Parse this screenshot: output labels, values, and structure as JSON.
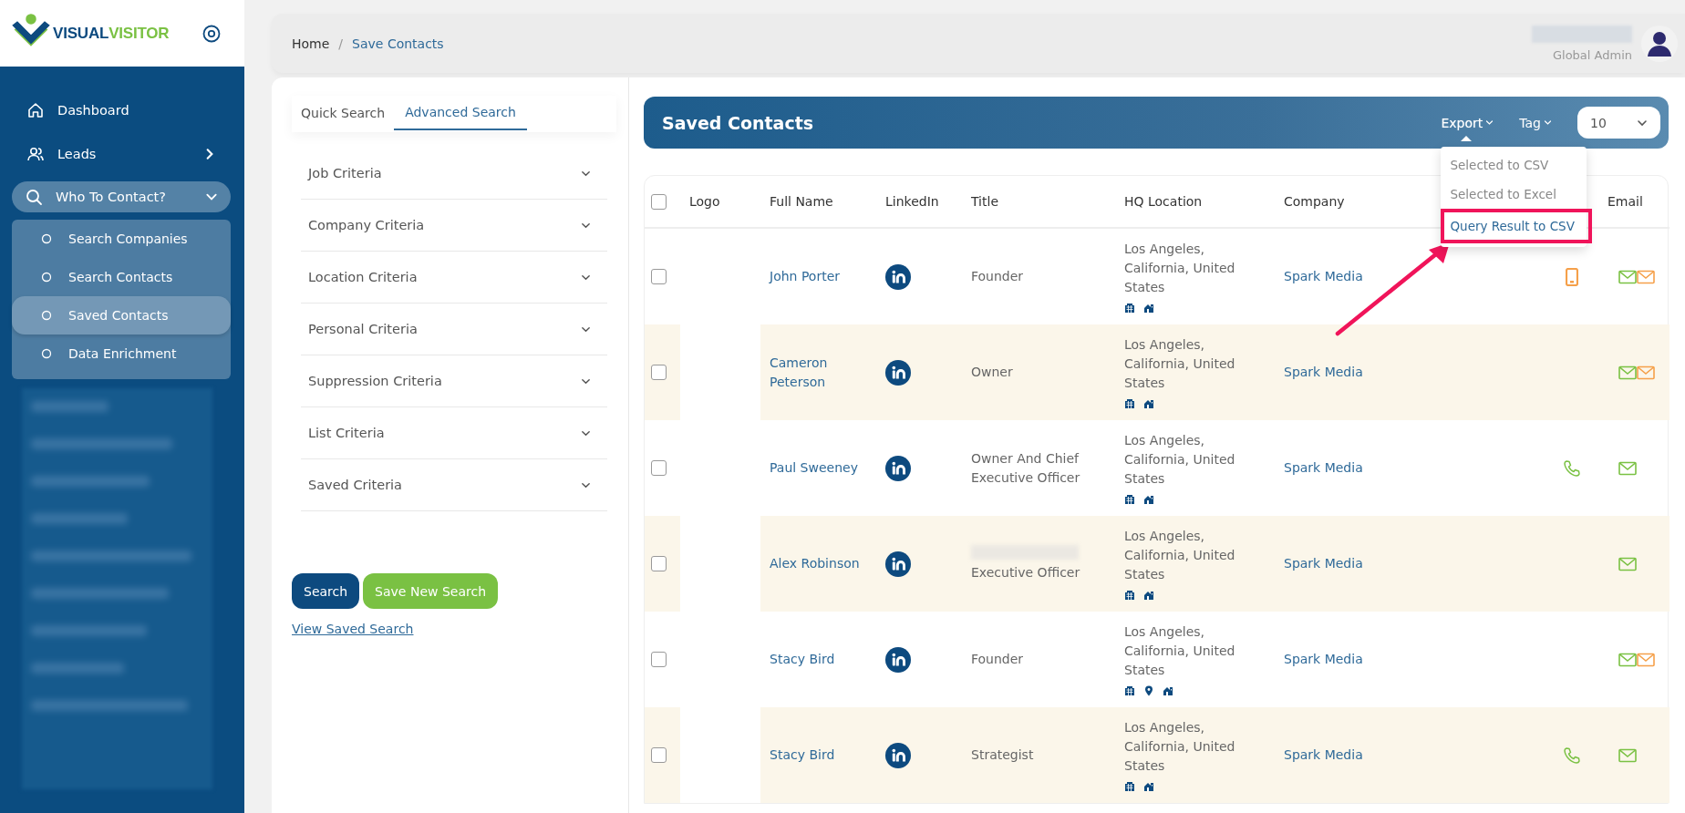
{
  "sidebar": {
    "logo": [
      {
        "text": "VISUAL",
        "color": "#0d4a7f"
      },
      {
        "text": "VISITOR",
        "color": "#7ac143"
      }
    ],
    "items": [
      {
        "label": "Dashboard",
        "selected": false
      },
      {
        "label": "Leads",
        "expanded": false,
        "selected": false
      },
      {
        "label": "Who To Contact?",
        "expanded": true,
        "selected": true,
        "children": [
          {
            "label": "Search Companies",
            "selected": false
          },
          {
            "label": "Search Contacts",
            "selected": false
          },
          {
            "label": "Saved Contacts",
            "selected": true
          },
          {
            "label": "Data Enrichment",
            "selected": false
          }
        ]
      }
    ]
  },
  "breadcrumb": {
    "items": [
      "Home",
      "Save Contacts"
    ],
    "separator": "/"
  },
  "user": {
    "role": "Global Admin"
  },
  "search_panel": {
    "tabs": [
      {
        "label": "Quick Search",
        "selected": false
      },
      {
        "label": "Advanced Search",
        "selected": true
      }
    ],
    "criteria": [
      {
        "label": "Job Criteria",
        "expanded": false
      },
      {
        "label": "Company Criteria",
        "expanded": false
      },
      {
        "label": "Location Criteria",
        "expanded": false
      },
      {
        "label": "Personal Criteria",
        "expanded": false
      },
      {
        "label": "Suppression Criteria",
        "expanded": false
      },
      {
        "label": "List Criteria",
        "expanded": false
      },
      {
        "label": "Saved Criteria",
        "expanded": false
      }
    ],
    "search_button": "Search",
    "save_button": "Save New Search",
    "saved_link": "View Saved Search"
  },
  "results": {
    "title": "Saved Contacts",
    "export": {
      "label": "Export",
      "expanded": true,
      "menu": [
        {
          "label": "Selected to CSV",
          "highlighted": false
        },
        {
          "label": "Selected to Excel",
          "highlighted": false
        },
        {
          "label": "Query Result to CSV",
          "highlighted": true
        }
      ]
    },
    "tag": {
      "label": "Tag",
      "expanded": false
    },
    "page_size": "10",
    "annotation_arrow": true,
    "table": {
      "select_all": {
        "checked": false
      },
      "columns": [
        {
          "kind": "check"
        },
        {
          "kind": "text",
          "label": "Logo"
        },
        {
          "kind": "text",
          "label": "Full Name"
        },
        {
          "kind": "text",
          "label": "LinkedIn"
        },
        {
          "kind": "text",
          "label": "Title"
        },
        {
          "kind": "text",
          "label": "HQ Location"
        },
        {
          "kind": "text",
          "label": "Company"
        },
        {
          "kind": "phone"
        },
        {
          "kind": "text",
          "label": "Email"
        }
      ],
      "rows": [
        {
          "checked": false,
          "full_name": "John Porter",
          "title": "Founder",
          "location": "Los Angeles, California, United States",
          "location_icons": [
            {
              "kind": "building"
            },
            {
              "kind": "house"
            }
          ],
          "company": "Spark Media",
          "phone": {
            "kind": "mobile",
            "color": "#f5a04a"
          },
          "emails": [
            {
              "color": "#7ac143"
            },
            {
              "color": "#f5a04a"
            }
          ]
        },
        {
          "checked": false,
          "full_name": "Cameron Peterson",
          "title": "Owner",
          "location": "Los Angeles, California, United States",
          "location_icons": [
            {
              "kind": "building"
            },
            {
              "kind": "house"
            }
          ],
          "company": "Spark Media",
          "emails": [
            {
              "color": "#7ac143"
            },
            {
              "color": "#f5a04a"
            }
          ]
        },
        {
          "checked": false,
          "full_name": "Paul Sweeney",
          "title": "Owner And Chief Executive Officer",
          "location": "Los Angeles, California, United States",
          "location_icons": [
            {
              "kind": "building"
            },
            {
              "kind": "house"
            }
          ],
          "company": "Spark Media",
          "phone": {
            "kind": "phone",
            "color": "#7ac143"
          },
          "emails": [
            {
              "color": "#7ac143"
            }
          ]
        },
        {
          "checked": false,
          "full_name": "Alex Robinson",
          "title": "Executive Officer",
          "title_redacted": true,
          "location": "Los Angeles, California, United States",
          "location_icons": [
            {
              "kind": "building"
            },
            {
              "kind": "house"
            }
          ],
          "company": "Spark Media",
          "emails": [
            {
              "color": "#7ac143"
            }
          ]
        },
        {
          "checked": false,
          "full_name": "Stacy Bird",
          "title": "Founder",
          "location": "Los Angeles, California, United States",
          "location_icons": [
            {
              "kind": "building"
            },
            {
              "kind": "pin"
            },
            {
              "kind": "house"
            }
          ],
          "company": "Spark Media",
          "emails": [
            {
              "color": "#7ac143"
            },
            {
              "color": "#f5a04a"
            }
          ]
        },
        {
          "checked": false,
          "full_name": "Stacy Bird",
          "title": "Strategist",
          "location": "Los Angeles, California, United States",
          "location_icons": [
            {
              "kind": "building"
            },
            {
              "kind": "house"
            }
          ],
          "company": "Spark Media",
          "phone": {
            "kind": "phone",
            "color": "#7ac143"
          },
          "emails": [
            {
              "color": "#7ac143"
            }
          ]
        }
      ]
    }
  }
}
